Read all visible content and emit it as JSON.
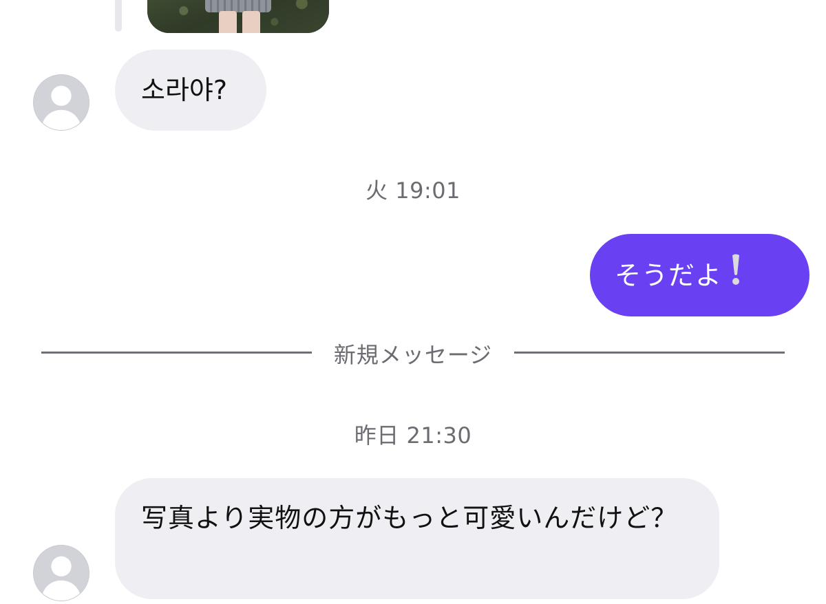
{
  "conversation": {
    "messages": [
      {
        "direction": "incoming",
        "type": "photo",
        "text": ""
      },
      {
        "direction": "incoming",
        "type": "text",
        "text": "소라야?"
      },
      {
        "direction": "outgoing",
        "type": "text",
        "text": "そうだよ",
        "emoji": "exclamation-mark-emoji"
      },
      {
        "direction": "incoming",
        "type": "text",
        "text": "写真より実物の方がもっと可愛いんだけど？"
      }
    ],
    "timestamps": [
      "火 19:01",
      "昨日 21:30"
    ],
    "new_messages_divider": "新規メッセージ"
  },
  "colors": {
    "outgoing_bubble": "#6941f2",
    "incoming_bubble": "#eeeef3",
    "meta_text": "#6b6b72",
    "emoji_exclamation": "#c7c7cc"
  }
}
